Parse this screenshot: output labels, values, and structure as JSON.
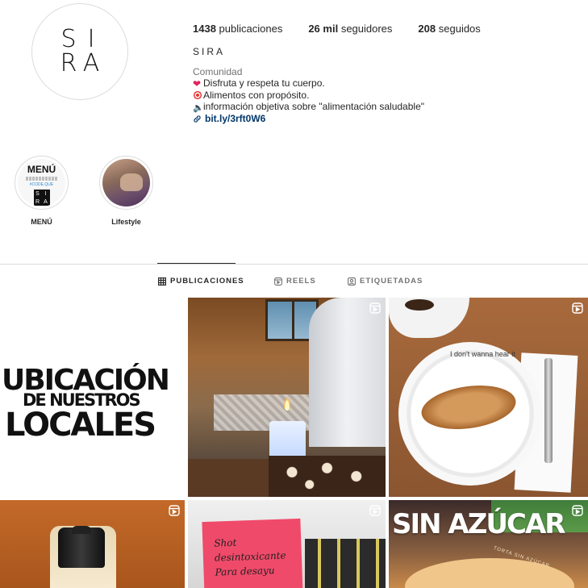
{
  "profile": {
    "avatar_letters": [
      "S",
      "I",
      "R",
      "A"
    ],
    "stats": {
      "posts_count": "1438",
      "posts_label": "publicaciones",
      "followers_count": "26 mil",
      "followers_label": "seguidores",
      "following_count": "208",
      "following_label": "seguidos"
    },
    "username": "SIRA",
    "category": "Comunidad",
    "bio_lines": [
      "Disfruta y respeta tu cuerpo.",
      "Alimentos con propósito.",
      "información objetiva sobre \"alimentación saludable\""
    ],
    "link": "bit.ly/3rft0W6"
  },
  "highlights": [
    {
      "label": "MENÚ",
      "cover_title": "MENÚ",
      "cover_code": "#CODE.QUE",
      "cover_logo": [
        "S",
        "I",
        "R",
        "A"
      ]
    },
    {
      "label": "Lifestyle"
    }
  ],
  "tabs": [
    {
      "label": "PUBLICACIONES",
      "icon": "grid-icon",
      "active": true
    },
    {
      "label": "REELS",
      "icon": "reels-icon",
      "active": false
    },
    {
      "label": "ETIQUETADAS",
      "icon": "tagged-icon",
      "active": false
    }
  ],
  "posts": [
    {
      "type": "image",
      "lines": [
        "UBICACIÓN",
        "DE NUESTROS",
        "LOCALES"
      ]
    },
    {
      "type": "reel"
    },
    {
      "type": "reel",
      "caption": "I don't wanna hear it"
    },
    {
      "type": "reel"
    },
    {
      "type": "reel",
      "note": [
        "Shot",
        "desintoxicante",
        "Para desayu"
      ]
    },
    {
      "type": "reel",
      "title": "SIN AZÚCAR",
      "subtitle": "TORTA SIN AZÚCAR"
    }
  ],
  "colors": {
    "link": "#00376b",
    "muted": "#737373",
    "text": "#262626",
    "border": "#dbdbdb"
  }
}
